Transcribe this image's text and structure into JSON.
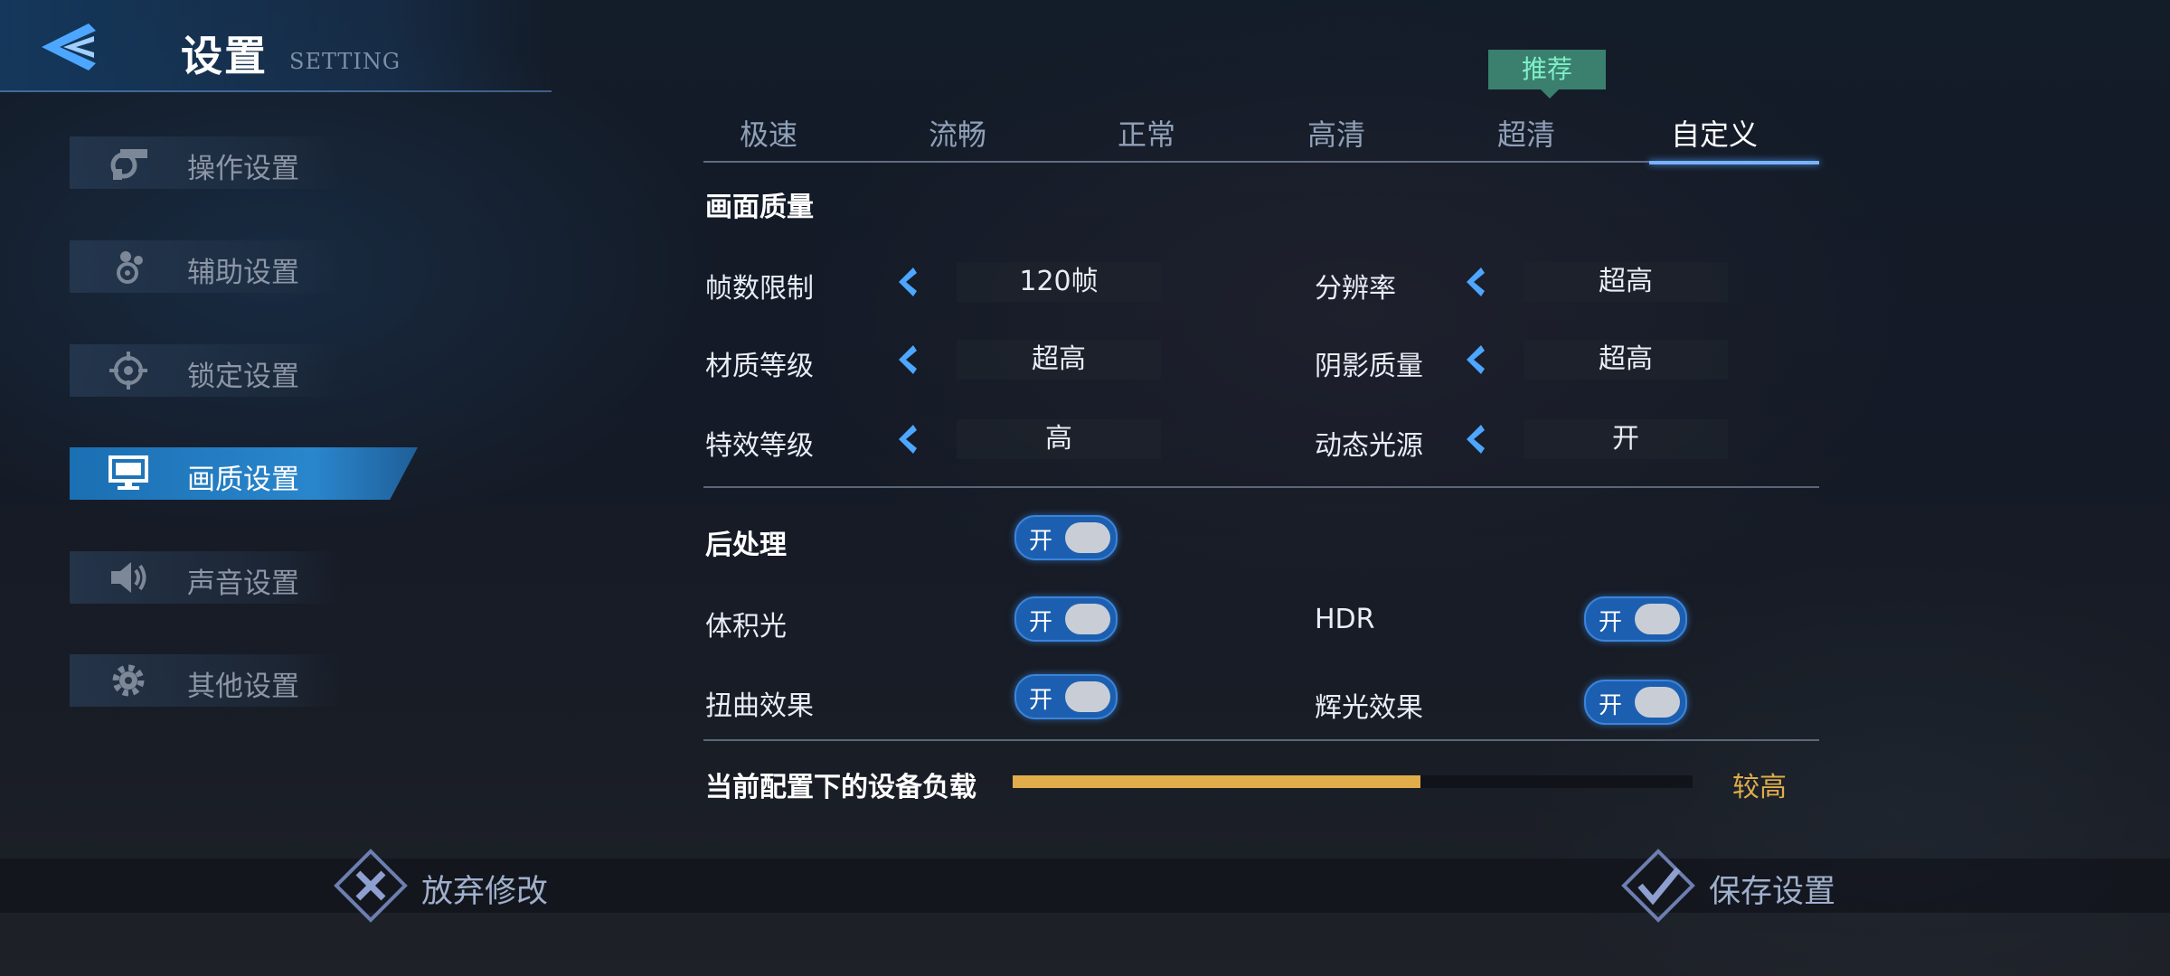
{
  "header": {
    "title": "设置",
    "subtitle": "SETTING",
    "back_icon": "back-arrow-icon"
  },
  "sidebar": {
    "items": [
      {
        "label": "操作设置",
        "icon": "gun-gear-icon",
        "active": false
      },
      {
        "label": "辅助设置",
        "icon": "dots-cluster-icon",
        "active": false
      },
      {
        "label": "锁定设置",
        "icon": "crosshair-icon",
        "active": false
      },
      {
        "label": "画质设置",
        "icon": "monitor-icon",
        "active": true
      },
      {
        "label": "声音设置",
        "icon": "speaker-icon",
        "active": false
      },
      {
        "label": "其他设置",
        "icon": "gear-icon",
        "active": false
      }
    ]
  },
  "quality_tabs": {
    "badge": "推荐",
    "badge_color": "#3b7f6e",
    "items": [
      "极速",
      "流畅",
      "正常",
      "高清",
      "超清",
      "自定义"
    ],
    "active_index": 5
  },
  "picture_quality": {
    "section_title": "画面质量",
    "settings": [
      {
        "label": "帧数限制",
        "value": "120帧"
      },
      {
        "label": "分辨率",
        "value": "超高"
      },
      {
        "label": "材质等级",
        "value": "超高"
      },
      {
        "label": "阴影质量",
        "value": "超高"
      },
      {
        "label": "特效等级",
        "value": "高"
      },
      {
        "label": "动态光源",
        "value": "开"
      }
    ]
  },
  "post_processing": {
    "section_title": "后处理",
    "section_toggle": "开",
    "toggles": [
      {
        "label": "体积光",
        "state": "开"
      },
      {
        "label": "HDR",
        "state": "开"
      },
      {
        "label": "扭曲效果",
        "state": "开"
      },
      {
        "label": "辉光效果",
        "state": "开"
      }
    ]
  },
  "device_load": {
    "label": "当前配置下的设备负载",
    "level_text": "较高",
    "fraction": 0.6,
    "color": "#e0ad4a"
  },
  "footer": {
    "discard_label": "放弃修改",
    "save_label": "保存设置"
  }
}
